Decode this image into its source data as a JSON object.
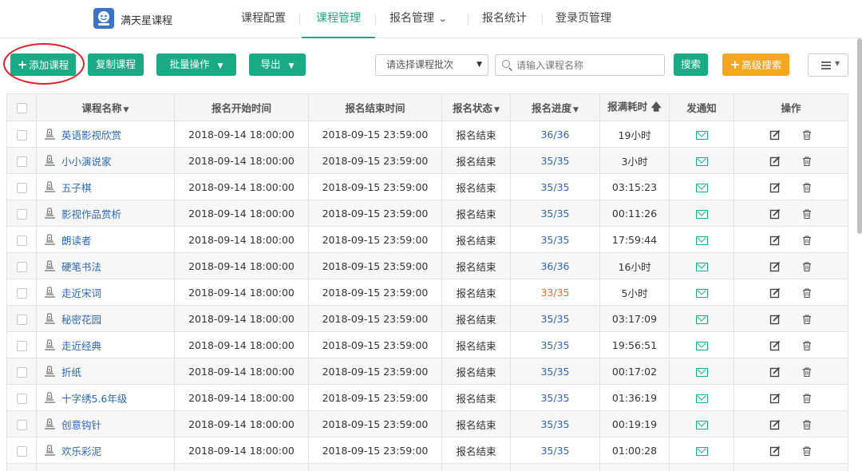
{
  "app": {
    "logo_text": "满天星课程"
  },
  "nav": {
    "items": [
      {
        "label": "课程配置"
      },
      {
        "label": "课程管理"
      },
      {
        "label": "报名管理"
      },
      {
        "label": "报名统计"
      },
      {
        "label": "登录页管理"
      }
    ]
  },
  "toolbar": {
    "add_course": "添加课程",
    "copy_course": "复制课程",
    "batch_ops": "批量操作",
    "export": "导出",
    "batch_select": "请选择课程批次",
    "search_placeholder": "请输入课程名称",
    "search": "搜索",
    "advanced_search": "高级搜索"
  },
  "table": {
    "headers": {
      "name": "课程名称",
      "start": "报名开始时间",
      "end": "报名结束时间",
      "status": "报名状态",
      "progress": "报名进度",
      "duration": "报满耗时",
      "notify": "发通知",
      "ops": "操作"
    },
    "rows": [
      {
        "name": "英语影视欣赏",
        "start": "2018-09-14 18:00:00",
        "end": "2018-09-15 23:59:00",
        "status": "报名结束",
        "progress": "36/36",
        "duration": "19小时"
      },
      {
        "name": "小小演说家",
        "start": "2018-09-14 18:00:00",
        "end": "2018-09-15 23:59:00",
        "status": "报名结束",
        "progress": "35/35",
        "duration": "3小时"
      },
      {
        "name": "五子棋",
        "start": "2018-09-14 18:00:00",
        "end": "2018-09-15 23:59:00",
        "status": "报名结束",
        "progress": "35/35",
        "duration": "03:15:23"
      },
      {
        "name": "影视作品赏析",
        "start": "2018-09-14 18:00:00",
        "end": "2018-09-15 23:59:00",
        "status": "报名结束",
        "progress": "35/35",
        "duration": "00:11:26"
      },
      {
        "name": "朗读者",
        "start": "2018-09-14 18:00:00",
        "end": "2018-09-15 23:59:00",
        "status": "报名结束",
        "progress": "35/35",
        "duration": "17:59:44"
      },
      {
        "name": "硬笔书法",
        "start": "2018-09-14 18:00:00",
        "end": "2018-09-15 23:59:00",
        "status": "报名结束",
        "progress": "36/36",
        "duration": "16小时"
      },
      {
        "name": "走近宋词",
        "start": "2018-09-14 18:00:00",
        "end": "2018-09-15 23:59:00",
        "status": "报名结束",
        "progress": "33/35",
        "duration": "5小时"
      },
      {
        "name": "秘密花园",
        "start": "2018-09-14 18:00:00",
        "end": "2018-09-15 23:59:00",
        "status": "报名结束",
        "progress": "35/35",
        "duration": "03:17:09"
      },
      {
        "name": "走近经典",
        "start": "2018-09-14 18:00:00",
        "end": "2018-09-15 23:59:00",
        "status": "报名结束",
        "progress": "35/35",
        "duration": "19:56:51"
      },
      {
        "name": "折纸",
        "start": "2018-09-14 18:00:00",
        "end": "2018-09-15 23:59:00",
        "status": "报名结束",
        "progress": "35/35",
        "duration": "00:17:02"
      },
      {
        "name": "十字绣5.6年级",
        "start": "2018-09-14 18:00:00",
        "end": "2018-09-15 23:59:00",
        "status": "报名结束",
        "progress": "35/35",
        "duration": "01:36:19"
      },
      {
        "name": "创意钩针",
        "start": "2018-09-14 18:00:00",
        "end": "2018-09-15 23:59:00",
        "status": "报名结束",
        "progress": "35/35",
        "duration": "00:19:19"
      },
      {
        "name": "欢乐彩泥",
        "start": "2018-09-14 18:00:00",
        "end": "2018-09-15 23:59:00",
        "status": "报名结束",
        "progress": "35/35",
        "duration": "01:00:28"
      }
    ]
  },
  "colors": {
    "accent": "#1aab85",
    "orange": "#f5a623",
    "link": "#2a67b8",
    "warn": "#e8672a"
  }
}
